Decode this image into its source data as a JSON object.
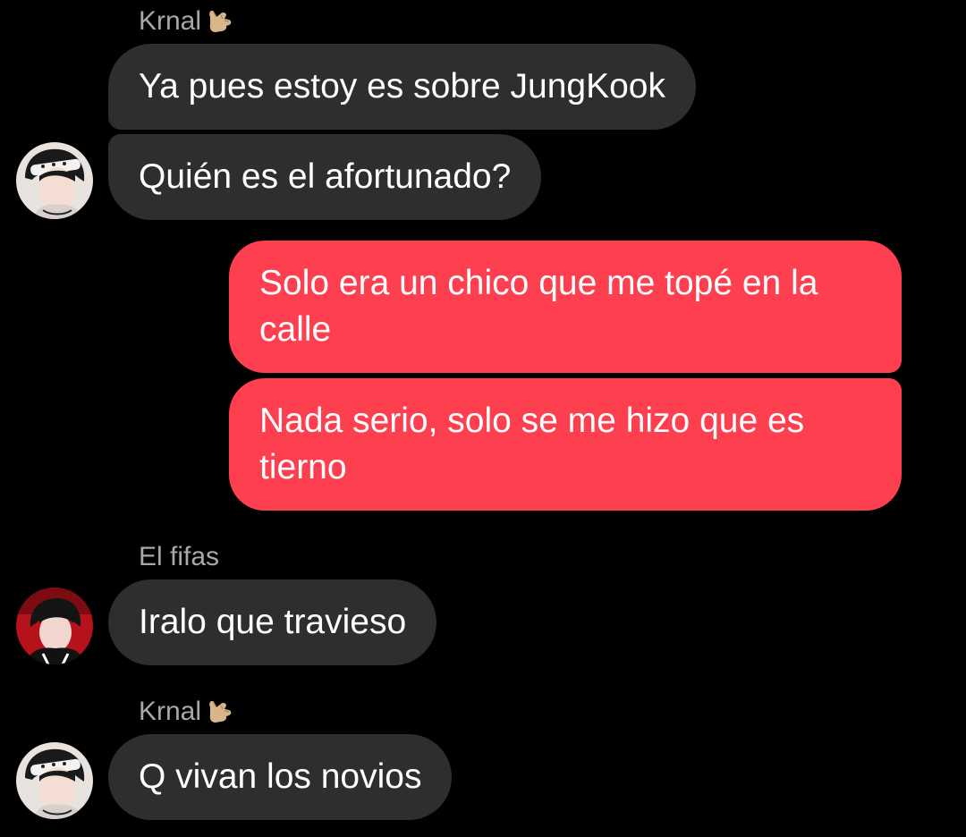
{
  "colors": {
    "background": "#000000",
    "incoming_bubble": "#2e2e2e",
    "outgoing_bubble": "#fd3f4f",
    "sender_name": "#a8a8a8",
    "text": "#ffffff"
  },
  "conversation": {
    "group1": {
      "sender": "Krnal",
      "sender_emoji": "call-me-hand-emoji",
      "messages": [
        "Ya pues estoy es sobre JungKook",
        "Quién es el afortunado?"
      ],
      "avatar": "avatar-krnal"
    },
    "outgoing": {
      "messages": [
        "Solo era un chico que me topé en la calle",
        "Nada serio, solo se me hizo que es tierno"
      ]
    },
    "group2": {
      "sender": "El fifas",
      "messages": [
        "Iralo que travieso"
      ],
      "avatar": "avatar-el-fifas"
    },
    "group3": {
      "sender": "Krnal",
      "sender_emoji": "call-me-hand-emoji",
      "messages": [
        "Q vivan los novios"
      ],
      "avatar": "avatar-krnal"
    }
  }
}
